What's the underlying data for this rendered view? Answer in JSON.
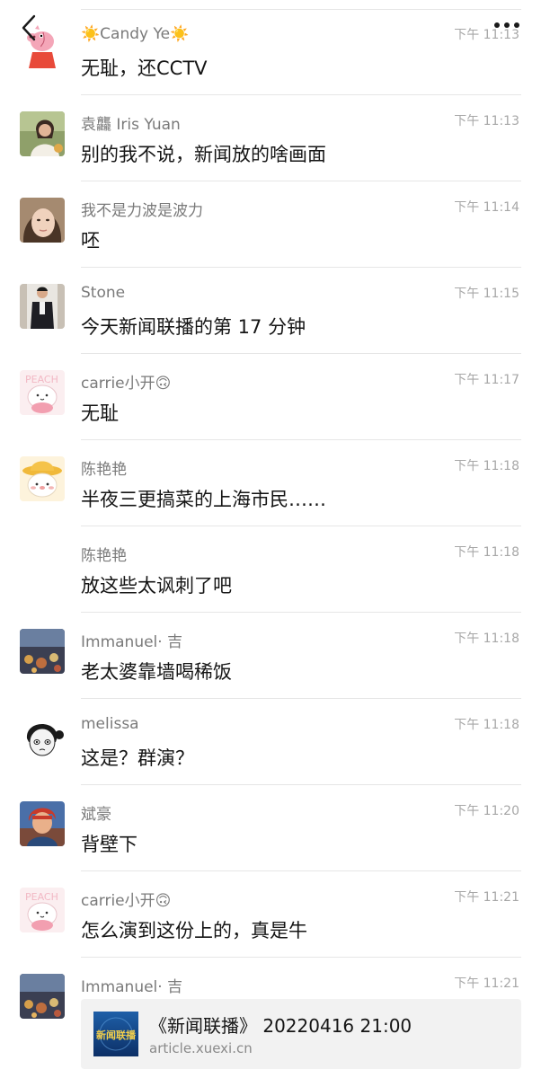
{
  "nav": {
    "back_icon": "chevron-left-icon",
    "more_icon": "ellipsis-icon"
  },
  "messages": [
    {
      "name": "☀️Candy Ye☀️",
      "time": "下午 11:13",
      "text": "无耻，还CCTV",
      "avatar": "peppa-pig-avatar"
    },
    {
      "name": "袁龘 Iris Yuan",
      "time": "下午 11:13",
      "text": "别的我不说，新闻放的啥画面",
      "avatar": "woman-photo-avatar"
    },
    {
      "name": "我不是力波是波力",
      "time": "下午 11:14",
      "text": "呸",
      "avatar": "selfie-photo-avatar"
    },
    {
      "name": "Stone",
      "time": "下午 11:15",
      "text": "今天新闻联播的第 17 分钟",
      "avatar": "man-photo-avatar"
    },
    {
      "name": "carrie小开🙃",
      "time": "下午 11:17",
      "text": "无耻",
      "avatar": "peach-cartoon-avatar"
    },
    {
      "name": "陈艳艳",
      "time": "下午 11:18",
      "text": "半夜三更搞菜的上海市民……",
      "avatar": "cartoon-hat-avatar"
    },
    {
      "name": "陈艳艳",
      "time": "下午 11:18",
      "text": "放这些太讽刺了吧",
      "avatar": ""
    },
    {
      "name": "Immanuel· 吉",
      "time": "下午 11:18",
      "text": "老太婆靠墙喝稀饭",
      "avatar": "city-lights-avatar"
    },
    {
      "name": "melissa",
      "time": "下午 11:18",
      "text": "这是？群演？",
      "avatar": "cartoon-girl-avatar"
    },
    {
      "name": "斌豪",
      "time": "下午 11:20",
      "text": "背壁下",
      "avatar": "anime-character-avatar"
    },
    {
      "name": "carrie小开🙃",
      "time": "下午 11:21",
      "text": "怎么演到这份上的，真是牛",
      "avatar": "peach-cartoon-avatar"
    }
  ],
  "last_message": {
    "name": "Immanuel· 吉",
    "time": "下午 11:21",
    "avatar": "city-lights-avatar",
    "link": {
      "title": "《新闻联播》 20220416 21:00",
      "url": "article.xuexi.cn",
      "thumb_text": "新闻联播"
    }
  }
}
